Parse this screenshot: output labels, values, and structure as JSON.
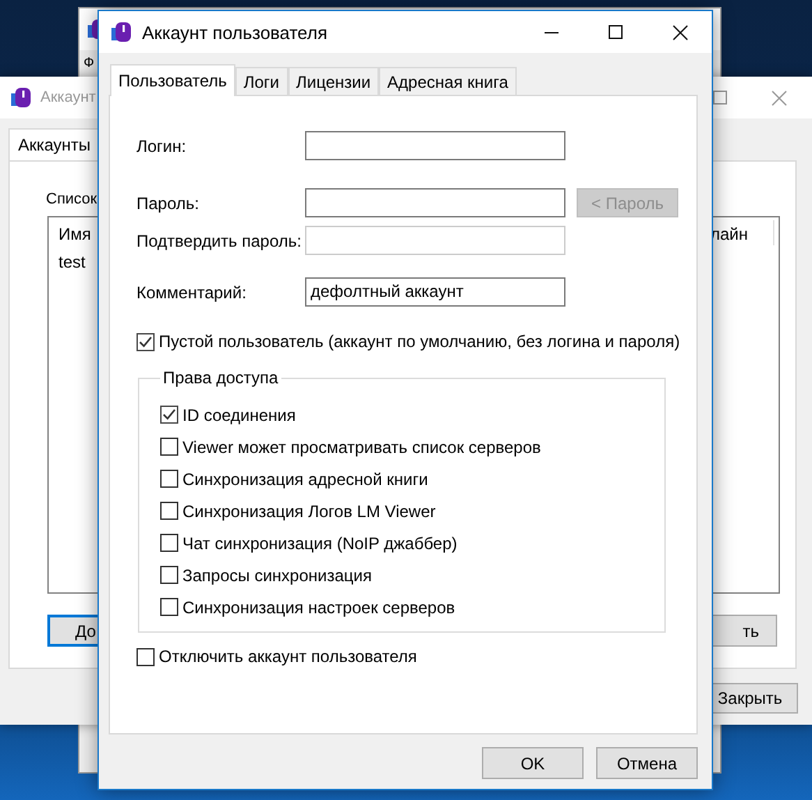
{
  "back_window_top": {
    "label": "Ф"
  },
  "back_window": {
    "title": "Аккаунт",
    "tabs": [
      {
        "label": "Аккаунты",
        "selected": true
      }
    ],
    "list_label": "Список",
    "list": {
      "columns": [
        "Имя",
        "лайн"
      ],
      "rows": [
        "test"
      ]
    },
    "buttons": [
      {
        "label": "До",
        "default": true
      },
      {
        "label": "ть",
        "default": false
      }
    ],
    "close_button": "Закрыть"
  },
  "dialog": {
    "title": "Аккаунт пользователя",
    "tabs": [
      {
        "label": "Пользователь",
        "selected": true
      },
      {
        "label": "Логи",
        "selected": false
      },
      {
        "label": "Лицензии",
        "selected": false
      },
      {
        "label": "Адресная книга",
        "selected": false
      }
    ],
    "fields": [
      {
        "label": "Логин:",
        "disabled": false
      },
      {
        "label": "Пароль:",
        "disabled": false,
        "button": {
          "label": "< Пароль",
          "disabled": true
        }
      },
      {
        "label": "Подтвердить пароль:",
        "disabled": true
      },
      {
        "label": "Комментарий:",
        "value": "дефолтный аккаунт",
        "disabled": false
      }
    ],
    "empty_user": {
      "label": "Пустой пользователь (аккаунт по умолчанию, без логина и пароля)",
      "checked": true
    },
    "permissions": {
      "title": "Права доступа",
      "items": [
        {
          "label": "ID соединения",
          "checked": true
        },
        {
          "label": "Viewer может просматривать список серверов",
          "checked": false
        },
        {
          "label": "Синхронизация адресной книги",
          "checked": false
        },
        {
          "label": "Синхронизация Логов LM Viewer",
          "checked": false
        },
        {
          "label": "Чат синхронизация (NoIP джаббер)",
          "checked": false
        },
        {
          "label": "Запросы синхронизация",
          "checked": false
        },
        {
          "label": "Синхронизация настроек серверов",
          "checked": false
        }
      ]
    },
    "disable_account": {
      "label": "Отключить аккаунт пользователя",
      "checked": false
    },
    "buttons": [
      {
        "label": "OK"
      },
      {
        "label": "Отмена"
      }
    ]
  }
}
